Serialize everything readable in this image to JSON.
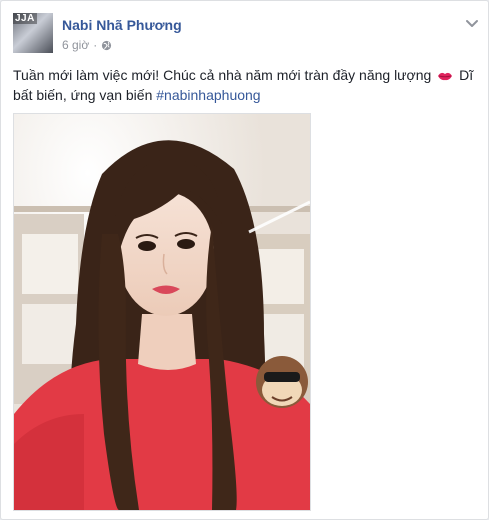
{
  "post": {
    "avatar_badge": "JJA",
    "author": "Nabi Nhã Phương",
    "time": "6 giờ",
    "privacy_icon": "globe-icon",
    "options_icon": "chevron-down-icon",
    "text_part1": "Tuần mới làm việc mới! Chúc cả nhà năm mới tràn đầy năng lượng",
    "text_emoji": "kiss-lips-emoji",
    "text_part2": " Dĩ bất biến, ứng vạn biến ",
    "hashtag": "#nabinhaphuong",
    "photo_alt": "selfie photo"
  },
  "colors": {
    "link": "#365899",
    "meta": "#90949c",
    "text": "#1d2129",
    "sweater": "#e23a45",
    "hair": "#3a2418"
  }
}
